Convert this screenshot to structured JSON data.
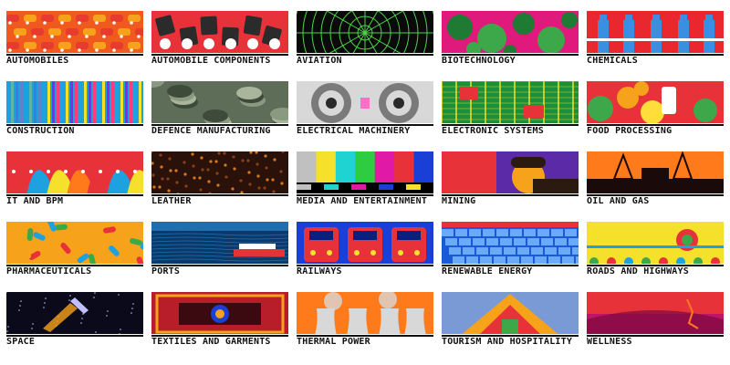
{
  "sectors": [
    {
      "label": "AUTOMOBILES",
      "icon": "car-pattern-icon",
      "colors": [
        "#f05a1e",
        "#f7a21b",
        "#e63b2e",
        "#ffffff"
      ]
    },
    {
      "label": "AUTOMOBILE COMPONENTS",
      "icon": "engine-parts-icon",
      "colors": [
        "#e8323a",
        "#2b2b2b",
        "#ffffff",
        "#c81e2a"
      ]
    },
    {
      "label": "AVIATION",
      "icon": "radar-icon",
      "colors": [
        "#0a0a0a",
        "#4ed34a",
        "#1a1a1a",
        "#6de85f"
      ]
    },
    {
      "label": "BIOTECHNOLOGY",
      "icon": "cells-icon",
      "colors": [
        "#e0197d",
        "#3ca84a",
        "#1f7a34",
        "#f24aa0"
      ]
    },
    {
      "label": "CHEMICALS",
      "icon": "flasks-icon",
      "colors": [
        "#e8282e",
        "#3b8fe0",
        "#ffffff",
        "#c51a20"
      ]
    },
    {
      "label": "CONSTRUCTION",
      "icon": "stripes-icon",
      "colors": [
        "#1da1e0",
        "#f5e12b",
        "#8a2be2",
        "#ff3c7a"
      ]
    },
    {
      "label": "DEFENCE MANUFACTURING",
      "icon": "camouflage-icon",
      "colors": [
        "#5d6d58",
        "#8a9a80",
        "#3e4a3a",
        "#aab59e"
      ]
    },
    {
      "label": "ELECTRICAL MACHINERY",
      "icon": "turbine-icon",
      "colors": [
        "#d8d8d8",
        "#7a7a7a",
        "#ff6ec7",
        "#2a2a2a"
      ]
    },
    {
      "label": "ELECTRONIC SYSTEMS",
      "icon": "circuit-board-icon",
      "colors": [
        "#1c8f3a",
        "#f5e12b",
        "#e8323a",
        "#0d5a22"
      ]
    },
    {
      "label": "FOOD PROCESSING",
      "icon": "fruits-icon",
      "colors": [
        "#e8323a",
        "#f7a21b",
        "#3ca84a",
        "#ffde3b"
      ]
    },
    {
      "label": "IT AND BPM",
      "icon": "profiles-icon",
      "colors": [
        "#e8323a",
        "#1da1e0",
        "#f5e12b",
        "#ff7a1a"
      ]
    },
    {
      "label": "LEATHER",
      "icon": "leather-texture-icon",
      "colors": [
        "#2a120a",
        "#8a3f1a",
        "#d6781e",
        "#4a2010"
      ]
    },
    {
      "label": "MEDIA AND ENTERTAINMENT",
      "icon": "color-bars-icon",
      "colors": [
        "#c0c0c0",
        "#f5e12b",
        "#1fd3d3",
        "#2ecc40",
        "#e01aa6",
        "#e8323a",
        "#1a3fd6",
        "#000000"
      ]
    },
    {
      "label": "MINING",
      "icon": "miner-icon",
      "colors": [
        "#5b2aa6",
        "#f7a21b",
        "#e8323a",
        "#2b1a10"
      ]
    },
    {
      "label": "OIL AND GAS",
      "icon": "oil-rig-icon",
      "colors": [
        "#e8322a",
        "#ff7a1a",
        "#1a0a0a",
        "#ffb02e"
      ]
    },
    {
      "label": "PHARMACEUTICALS",
      "icon": "pills-icon",
      "colors": [
        "#f7a21b",
        "#1da1e0",
        "#e8323a",
        "#3ca84a"
      ]
    },
    {
      "label": "PORTS",
      "icon": "ship-icon",
      "colors": [
        "#0b3a6a",
        "#1f6fb0",
        "#e8323a",
        "#ffffff"
      ]
    },
    {
      "label": "RAILWAYS",
      "icon": "train-icon",
      "colors": [
        "#1a3fd6",
        "#e8323a",
        "#f5e12b",
        "#0a1f7a"
      ]
    },
    {
      "label": "RENEWABLE ENERGY",
      "icon": "solar-panel-icon",
      "colors": [
        "#1a5ad6",
        "#7ab8ff",
        "#e8323a",
        "#0a2f8a"
      ]
    },
    {
      "label": "ROADS AND HIGHWAYS",
      "icon": "truck-art-icon",
      "colors": [
        "#f5e12b",
        "#3ca84a",
        "#e8323a",
        "#1da1e0"
      ]
    },
    {
      "label": "SPACE",
      "icon": "rocket-icon",
      "colors": [
        "#0a0a1a",
        "#f7a21b",
        "#c0c0ff",
        "#2a2a5a"
      ]
    },
    {
      "label": "TEXTILES AND GARMENTS",
      "icon": "carpet-icon",
      "colors": [
        "#b81e2a",
        "#f7a21b",
        "#1a3fd6",
        "#3a0a10"
      ]
    },
    {
      "label": "THERMAL POWER",
      "icon": "cooling-towers-icon",
      "colors": [
        "#ff7a1a",
        "#1da1e0",
        "#d8d8d8",
        "#e8322a"
      ]
    },
    {
      "label": "TOURISM AND HOSPITALITY",
      "icon": "temple-icon",
      "colors": [
        "#7a9ad6",
        "#e8323a",
        "#f7a21b",
        "#3ca84a"
      ]
    },
    {
      "label": "WELLNESS",
      "icon": "yoga-icon",
      "colors": [
        "#e8323a",
        "#c0136a",
        "#ff7a1a",
        "#7a0a3a"
      ]
    }
  ]
}
